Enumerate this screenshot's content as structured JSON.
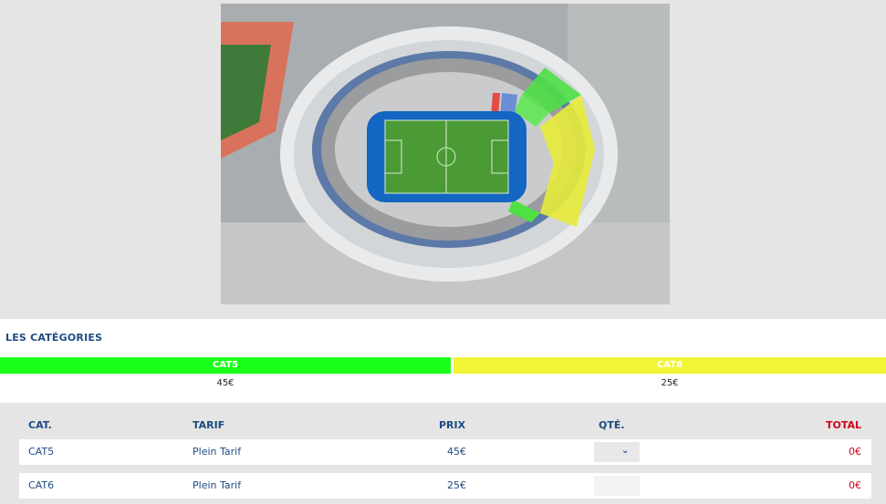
{
  "categories": {
    "title": "LES CATÉGORIES",
    "items": [
      {
        "name": "CAT5",
        "price": "45€",
        "color": "#1aff1a"
      },
      {
        "name": "CAT6",
        "price": "25€",
        "color": "#f1f535"
      }
    ]
  },
  "table": {
    "headers": {
      "cat": "CAT.",
      "tarif": "TARIF",
      "prix": "PRIX",
      "qte": "QTÉ.",
      "total": "TOTAL"
    },
    "rows": [
      {
        "cat": "CAT5",
        "tarif": "Plein Tarif",
        "prix": "45€",
        "total": "0€",
        "qty_enabled": true
      },
      {
        "cat": "CAT6",
        "tarif": "Plein Tarif",
        "prix": "25€",
        "total": "0€",
        "qty_enabled": false
      }
    ]
  },
  "colors": {
    "accent": "#1d4b82",
    "total": "#d0021b"
  }
}
